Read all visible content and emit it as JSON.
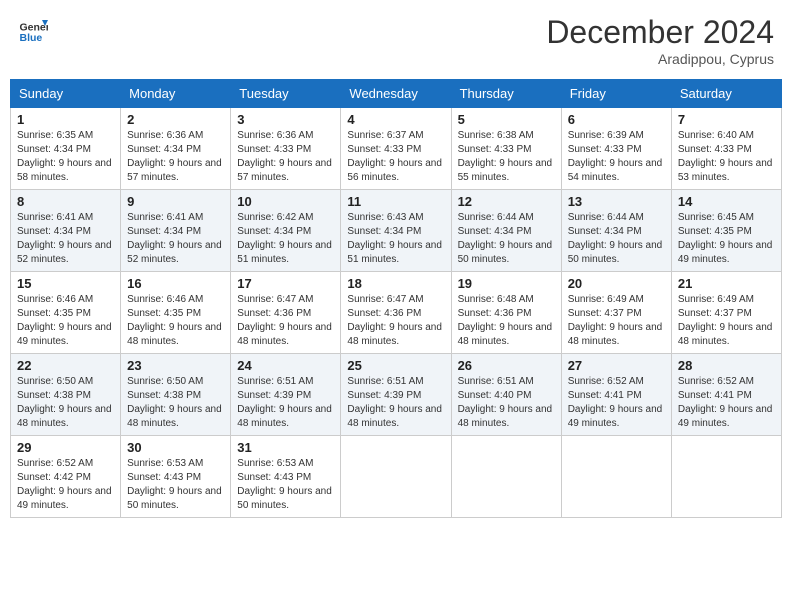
{
  "header": {
    "logo_line1": "General",
    "logo_line2": "Blue",
    "month_title": "December 2024",
    "location": "Aradippou, Cyprus"
  },
  "weekdays": [
    "Sunday",
    "Monday",
    "Tuesday",
    "Wednesday",
    "Thursday",
    "Friday",
    "Saturday"
  ],
  "weeks": [
    [
      {
        "day": "1",
        "sunrise": "Sunrise: 6:35 AM",
        "sunset": "Sunset: 4:34 PM",
        "daylight": "Daylight: 9 hours and 58 minutes."
      },
      {
        "day": "2",
        "sunrise": "Sunrise: 6:36 AM",
        "sunset": "Sunset: 4:34 PM",
        "daylight": "Daylight: 9 hours and 57 minutes."
      },
      {
        "day": "3",
        "sunrise": "Sunrise: 6:36 AM",
        "sunset": "Sunset: 4:33 PM",
        "daylight": "Daylight: 9 hours and 57 minutes."
      },
      {
        "day": "4",
        "sunrise": "Sunrise: 6:37 AM",
        "sunset": "Sunset: 4:33 PM",
        "daylight": "Daylight: 9 hours and 56 minutes."
      },
      {
        "day": "5",
        "sunrise": "Sunrise: 6:38 AM",
        "sunset": "Sunset: 4:33 PM",
        "daylight": "Daylight: 9 hours and 55 minutes."
      },
      {
        "day": "6",
        "sunrise": "Sunrise: 6:39 AM",
        "sunset": "Sunset: 4:33 PM",
        "daylight": "Daylight: 9 hours and 54 minutes."
      },
      {
        "day": "7",
        "sunrise": "Sunrise: 6:40 AM",
        "sunset": "Sunset: 4:33 PM",
        "daylight": "Daylight: 9 hours and 53 minutes."
      }
    ],
    [
      {
        "day": "8",
        "sunrise": "Sunrise: 6:41 AM",
        "sunset": "Sunset: 4:34 PM",
        "daylight": "Daylight: 9 hours and 52 minutes."
      },
      {
        "day": "9",
        "sunrise": "Sunrise: 6:41 AM",
        "sunset": "Sunset: 4:34 PM",
        "daylight": "Daylight: 9 hours and 52 minutes."
      },
      {
        "day": "10",
        "sunrise": "Sunrise: 6:42 AM",
        "sunset": "Sunset: 4:34 PM",
        "daylight": "Daylight: 9 hours and 51 minutes."
      },
      {
        "day": "11",
        "sunrise": "Sunrise: 6:43 AM",
        "sunset": "Sunset: 4:34 PM",
        "daylight": "Daylight: 9 hours and 51 minutes."
      },
      {
        "day": "12",
        "sunrise": "Sunrise: 6:44 AM",
        "sunset": "Sunset: 4:34 PM",
        "daylight": "Daylight: 9 hours and 50 minutes."
      },
      {
        "day": "13",
        "sunrise": "Sunrise: 6:44 AM",
        "sunset": "Sunset: 4:34 PM",
        "daylight": "Daylight: 9 hours and 50 minutes."
      },
      {
        "day": "14",
        "sunrise": "Sunrise: 6:45 AM",
        "sunset": "Sunset: 4:35 PM",
        "daylight": "Daylight: 9 hours and 49 minutes."
      }
    ],
    [
      {
        "day": "15",
        "sunrise": "Sunrise: 6:46 AM",
        "sunset": "Sunset: 4:35 PM",
        "daylight": "Daylight: 9 hours and 49 minutes."
      },
      {
        "day": "16",
        "sunrise": "Sunrise: 6:46 AM",
        "sunset": "Sunset: 4:35 PM",
        "daylight": "Daylight: 9 hours and 48 minutes."
      },
      {
        "day": "17",
        "sunrise": "Sunrise: 6:47 AM",
        "sunset": "Sunset: 4:36 PM",
        "daylight": "Daylight: 9 hours and 48 minutes."
      },
      {
        "day": "18",
        "sunrise": "Sunrise: 6:47 AM",
        "sunset": "Sunset: 4:36 PM",
        "daylight": "Daylight: 9 hours and 48 minutes."
      },
      {
        "day": "19",
        "sunrise": "Sunrise: 6:48 AM",
        "sunset": "Sunset: 4:36 PM",
        "daylight": "Daylight: 9 hours and 48 minutes."
      },
      {
        "day": "20",
        "sunrise": "Sunrise: 6:49 AM",
        "sunset": "Sunset: 4:37 PM",
        "daylight": "Daylight: 9 hours and 48 minutes."
      },
      {
        "day": "21",
        "sunrise": "Sunrise: 6:49 AM",
        "sunset": "Sunset: 4:37 PM",
        "daylight": "Daylight: 9 hours and 48 minutes."
      }
    ],
    [
      {
        "day": "22",
        "sunrise": "Sunrise: 6:50 AM",
        "sunset": "Sunset: 4:38 PM",
        "daylight": "Daylight: 9 hours and 48 minutes."
      },
      {
        "day": "23",
        "sunrise": "Sunrise: 6:50 AM",
        "sunset": "Sunset: 4:38 PM",
        "daylight": "Daylight: 9 hours and 48 minutes."
      },
      {
        "day": "24",
        "sunrise": "Sunrise: 6:51 AM",
        "sunset": "Sunset: 4:39 PM",
        "daylight": "Daylight: 9 hours and 48 minutes."
      },
      {
        "day": "25",
        "sunrise": "Sunrise: 6:51 AM",
        "sunset": "Sunset: 4:39 PM",
        "daylight": "Daylight: 9 hours and 48 minutes."
      },
      {
        "day": "26",
        "sunrise": "Sunrise: 6:51 AM",
        "sunset": "Sunset: 4:40 PM",
        "daylight": "Daylight: 9 hours and 48 minutes."
      },
      {
        "day": "27",
        "sunrise": "Sunrise: 6:52 AM",
        "sunset": "Sunset: 4:41 PM",
        "daylight": "Daylight: 9 hours and 49 minutes."
      },
      {
        "day": "28",
        "sunrise": "Sunrise: 6:52 AM",
        "sunset": "Sunset: 4:41 PM",
        "daylight": "Daylight: 9 hours and 49 minutes."
      }
    ],
    [
      {
        "day": "29",
        "sunrise": "Sunrise: 6:52 AM",
        "sunset": "Sunset: 4:42 PM",
        "daylight": "Daylight: 9 hours and 49 minutes."
      },
      {
        "day": "30",
        "sunrise": "Sunrise: 6:53 AM",
        "sunset": "Sunset: 4:43 PM",
        "daylight": "Daylight: 9 hours and 50 minutes."
      },
      {
        "day": "31",
        "sunrise": "Sunrise: 6:53 AM",
        "sunset": "Sunset: 4:43 PM",
        "daylight": "Daylight: 9 hours and 50 minutes."
      },
      null,
      null,
      null,
      null
    ]
  ]
}
